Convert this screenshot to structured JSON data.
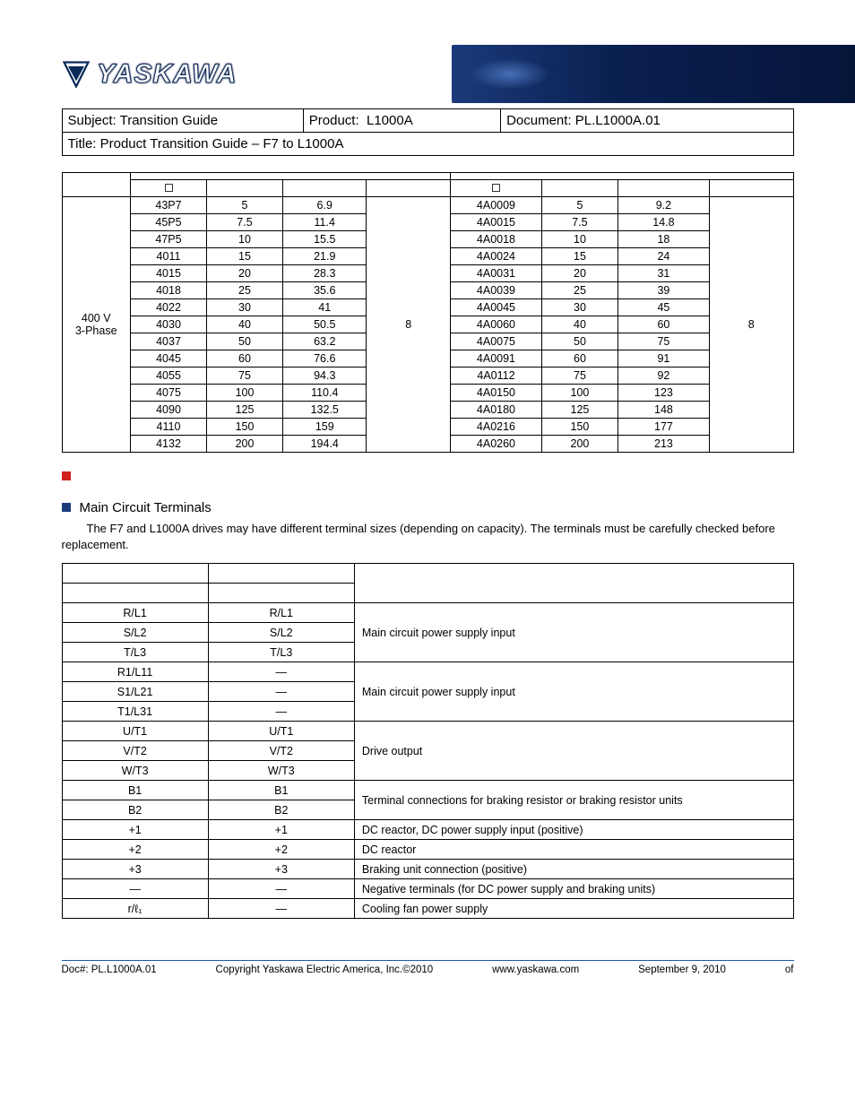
{
  "header": {
    "logo_text": "YASKAWA",
    "subject_label": "Subject:",
    "subject_value": "Transition Guide",
    "product_label": "Product:",
    "product_value": "L1000A",
    "document_label": "Document:",
    "document_value": "PL.L1000A.01",
    "title_label": "Title:",
    "title_value": "Product Transition Guide – F7 to L1000A"
  },
  "data_table": {
    "voltage_label": "400 V 3-Phase",
    "left_ol": "8",
    "right_ol": "8",
    "rows": [
      {
        "m": "43P7",
        "hp": "5",
        "a": "6.9",
        "m2": "4A0009",
        "hp2": "5",
        "a2": "9.2"
      },
      {
        "m": "45P5",
        "hp": "7.5",
        "a": "11.4",
        "m2": "4A0015",
        "hp2": "7.5",
        "a2": "14.8"
      },
      {
        "m": "47P5",
        "hp": "10",
        "a": "15.5",
        "m2": "4A0018",
        "hp2": "10",
        "a2": "18"
      },
      {
        "m": "4011",
        "hp": "15",
        "a": "21.9",
        "m2": "4A0024",
        "hp2": "15",
        "a2": "24"
      },
      {
        "m": "4015",
        "hp": "20",
        "a": "28.3",
        "m2": "4A0031",
        "hp2": "20",
        "a2": "31"
      },
      {
        "m": "4018",
        "hp": "25",
        "a": "35.6",
        "m2": "4A0039",
        "hp2": "25",
        "a2": "39"
      },
      {
        "m": "4022",
        "hp": "30",
        "a": "41",
        "m2": "4A0045",
        "hp2": "30",
        "a2": "45"
      },
      {
        "m": "4030",
        "hp": "40",
        "a": "50.5",
        "m2": "4A0060",
        "hp2": "40",
        "a2": "60"
      },
      {
        "m": "4037",
        "hp": "50",
        "a": "63.2",
        "m2": "4A0075",
        "hp2": "50",
        "a2": "75"
      },
      {
        "m": "4045",
        "hp": "60",
        "a": "76.6",
        "m2": "4A0091",
        "hp2": "60",
        "a2": "91"
      },
      {
        "m": "4055",
        "hp": "75",
        "a": "94.3",
        "m2": "4A0112",
        "hp2": "75",
        "a2": "92"
      },
      {
        "m": "4075",
        "hp": "100",
        "a": "110.4",
        "m2": "4A0150",
        "hp2": "100",
        "a2": "123"
      },
      {
        "m": "4090",
        "hp": "125",
        "a": "132.5",
        "m2": "4A0180",
        "hp2": "125",
        "a2": "148"
      },
      {
        "m": "4110",
        "hp": "150",
        "a": "159",
        "m2": "4A0216",
        "hp2": "150",
        "a2": "177"
      },
      {
        "m": "4132",
        "hp": "200",
        "a": "194.4",
        "m2": "4A0260",
        "hp2": "200",
        "a2": "213"
      }
    ]
  },
  "section": {
    "heading": "Main Circuit Terminals",
    "para": "The F7 and L1000A drives may have different terminal sizes (depending on capacity). The terminals must be carefully checked before replacement."
  },
  "terms_table": {
    "rows": [
      {
        "f7": "R/L1",
        "l": "R/L1",
        "desc": "Main circuit power supply input",
        "span": 3,
        "first": true
      },
      {
        "f7": "S/L2",
        "l": "S/L2"
      },
      {
        "f7": "T/L3",
        "l": "T/L3"
      },
      {
        "f7": "R1/L11",
        "l": "—",
        "desc": "Main circuit power supply input",
        "span": 3,
        "first": true
      },
      {
        "f7": "S1/L21",
        "l": "—"
      },
      {
        "f7": "T1/L31",
        "l": "—"
      },
      {
        "f7": "U/T1",
        "l": "U/T1",
        "desc": "Drive output",
        "span": 3,
        "first": true
      },
      {
        "f7": "V/T2",
        "l": "V/T2"
      },
      {
        "f7": "W/T3",
        "l": "W/T3"
      },
      {
        "f7": "B1",
        "l": "B1",
        "desc": "Terminal connections for braking resistor or braking resistor units",
        "span": 2,
        "first": true
      },
      {
        "f7": "B2",
        "l": "B2"
      },
      {
        "f7": "+1",
        "l": "+1",
        "desc": "DC reactor, DC power supply input (positive)",
        "span": 1,
        "first": true
      },
      {
        "f7": "+2",
        "l": "+2",
        "desc": "DC reactor",
        "span": 1,
        "first": true
      },
      {
        "f7": "+3",
        "l": "+3",
        "desc": "Braking unit connection (positive)",
        "span": 1,
        "first": true
      },
      {
        "f7": "—",
        "l": "—",
        "desc": "Negative terminals (for DC power supply and braking units)",
        "span": 1,
        "first": true
      },
      {
        "f7": "r/ℓ₁",
        "l": "—",
        "desc": "Cooling fan power supply",
        "span": 1,
        "first": true
      }
    ]
  },
  "footer": {
    "doc": "Doc#: PL.L1000A.01",
    "copyright": "Copyright Yaskawa Electric America, Inc.©2010",
    "url": "www.yaskawa.com",
    "date": "September 9, 2010",
    "of": "of"
  }
}
